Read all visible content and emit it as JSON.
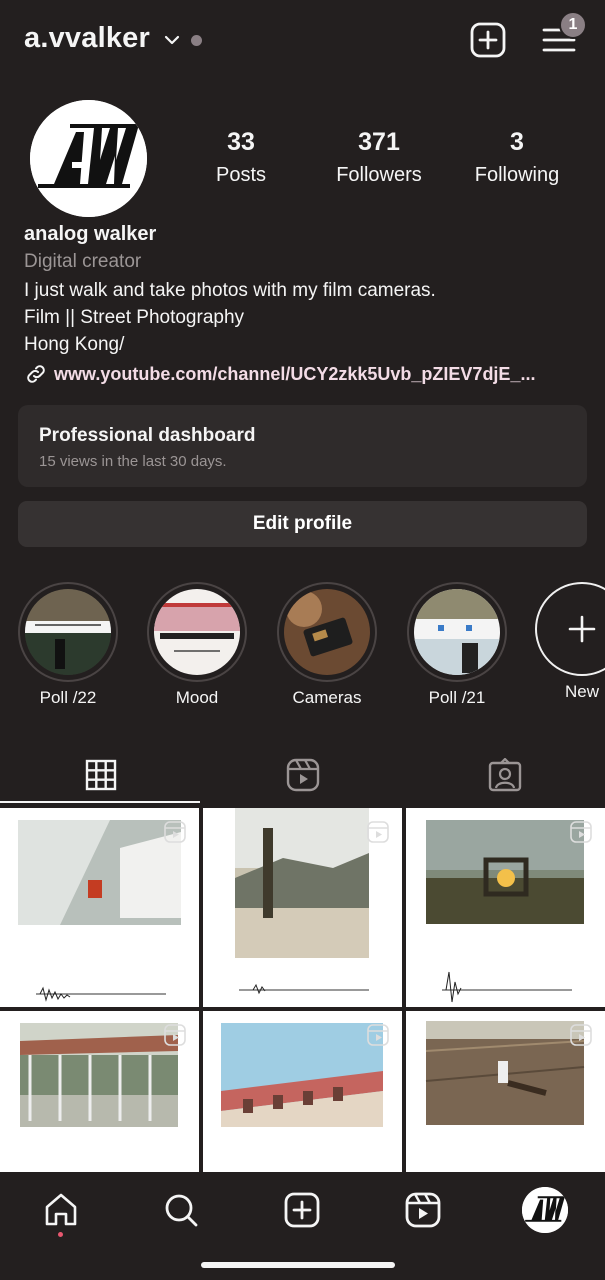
{
  "header": {
    "username": "a.vvalker",
    "notification_count": "1"
  },
  "profile": {
    "stats": [
      {
        "value": "33",
        "label": "Posts"
      },
      {
        "value": "371",
        "label": "Followers"
      },
      {
        "value": "3",
        "label": "Following"
      }
    ],
    "name": "analog walker",
    "category": "Digital creator",
    "bio_lines": [
      "I just walk and take photos with my film cameras.",
      "Film || Street Photography",
      "Hong Kong/"
    ],
    "link": "www.youtube.com/channel/UCY2zkk5Uvb_pZIEV7djE_..."
  },
  "dashboard": {
    "title": "Professional dashboard",
    "subtitle": "15 views in the last 30 days."
  },
  "edit_profile_label": "Edit profile",
  "highlights": [
    {
      "label": "Poll /22"
    },
    {
      "label": "Mood"
    },
    {
      "label": "Cameras"
    },
    {
      "label": "Poll /21"
    },
    {
      "label": "New"
    }
  ],
  "tabs": [
    {
      "icon": "grid-icon",
      "selected": true
    },
    {
      "icon": "reels-icon",
      "selected": false
    },
    {
      "icon": "tagged-icon",
      "selected": false
    }
  ],
  "bottom_nav": [
    {
      "icon": "home-icon"
    },
    {
      "icon": "search-icon"
    },
    {
      "icon": "create-icon"
    },
    {
      "icon": "reels-icon"
    },
    {
      "icon": "profile-avatar"
    }
  ],
  "colors": {
    "background": "#231f1f",
    "card": "#2f2b2b",
    "button": "#363232",
    "link": "#f3dce6",
    "muted": "#9b9595",
    "badge": "#8a7f84"
  }
}
